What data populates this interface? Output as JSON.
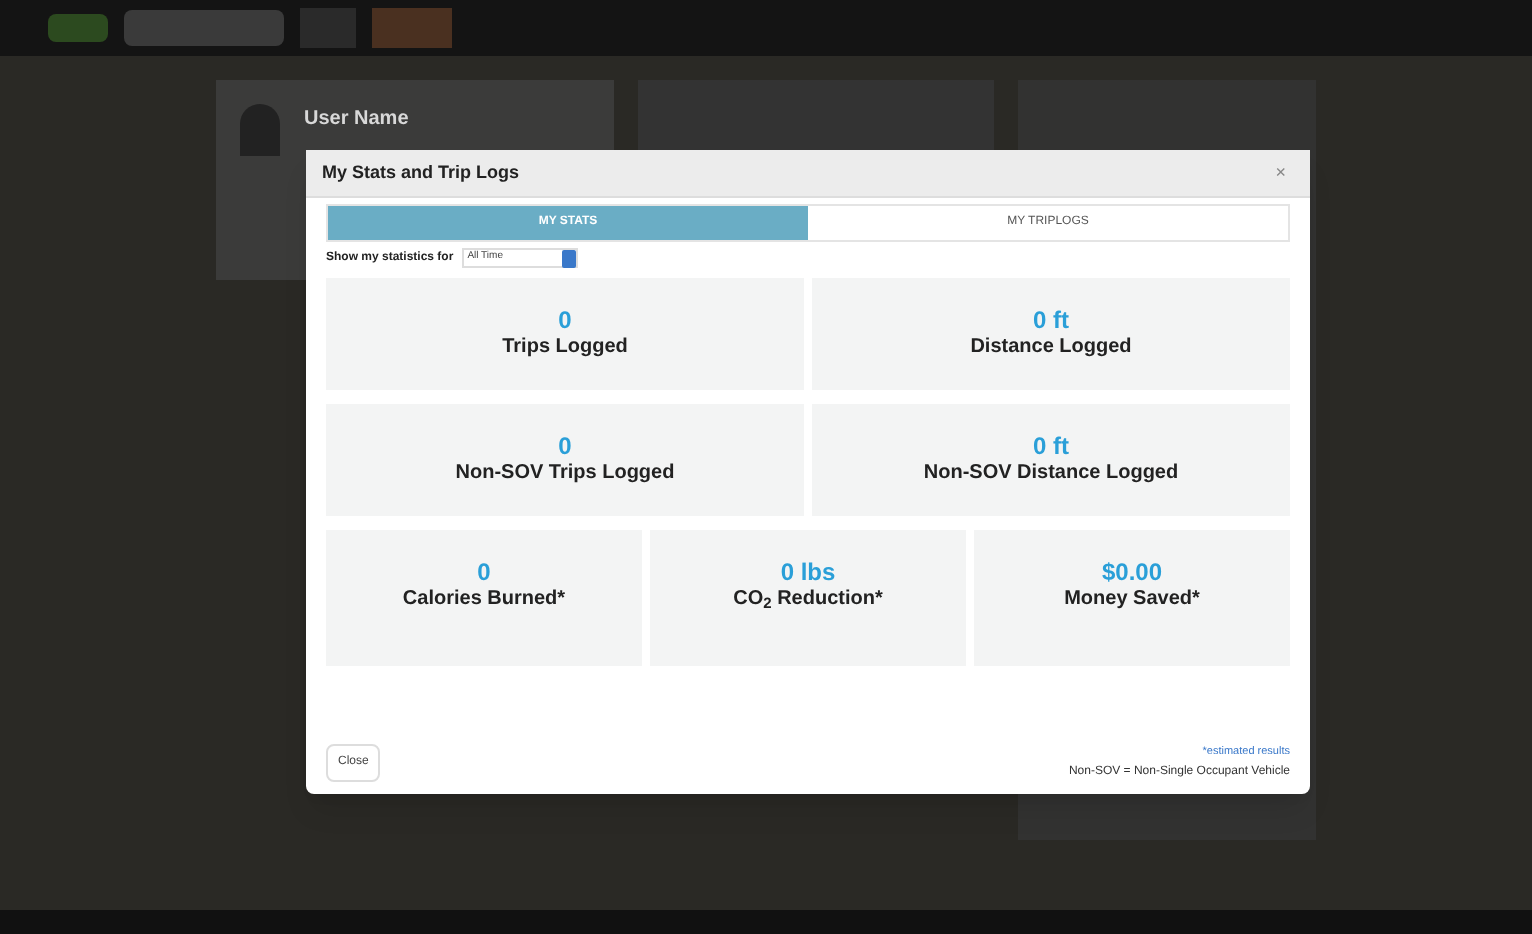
{
  "background": {
    "user_name": "User Name"
  },
  "dialog": {
    "title": "My Stats and Trip Logs",
    "close_icon": "×",
    "tabs": [
      {
        "label": "MY STATS",
        "selected": true
      },
      {
        "label": "MY TRIPLOGS",
        "selected": false
      }
    ],
    "period": {
      "label": "Show my statistics for",
      "value": "All Time"
    },
    "stat_rows": [
      [
        {
          "value": "0",
          "label": "Trips Logged"
        },
        {
          "value": "0 ft",
          "label": "Distance Logged"
        }
      ],
      [
        {
          "value": "0",
          "label": "Non-SOV Trips Logged"
        },
        {
          "value": "0 ft",
          "label": "Non-SOV Distance Logged"
        }
      ],
      [
        {
          "value": "0",
          "label": "Calories Burned*"
        },
        {
          "value": "0 lbs",
          "label": "CO$_{2}$ Reduction*"
        },
        {
          "value": "$0.00",
          "label": "Money Saved*"
        }
      ]
    ],
    "close_button": "Close",
    "footnote_link": "*estimated results",
    "footnote": "Non-SOV = Non-Single Occupant Vehicle"
  }
}
